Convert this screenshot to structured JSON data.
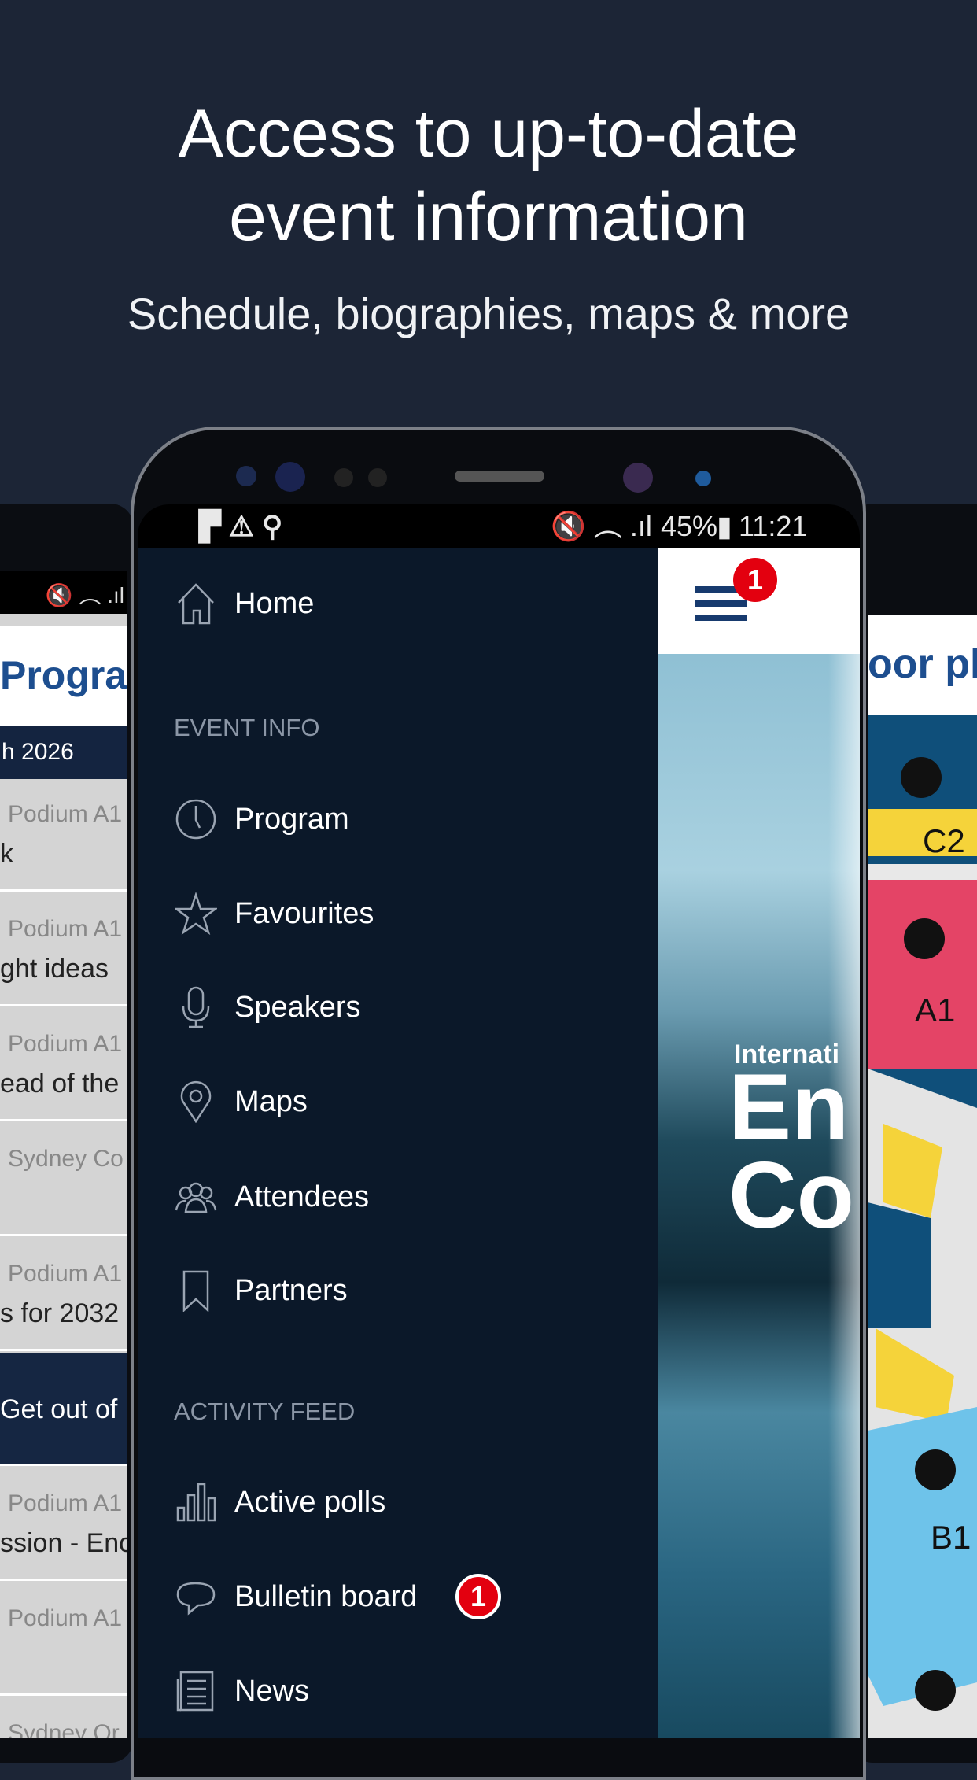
{
  "headline": {
    "line1": "Access to up-to-date",
    "line2": "event information",
    "subtitle": "Schedule, biographies, maps & more"
  },
  "status_bar": {
    "battery": "45%",
    "time": "11:21"
  },
  "drawer": {
    "home": "Home",
    "sections": [
      {
        "title": "EVENT INFO",
        "items": [
          "Program",
          "Favourites",
          "Speakers",
          "Maps",
          "Attendees",
          "Partners"
        ]
      },
      {
        "title": "ACTIVITY FEED",
        "items": [
          "Active polls",
          "Bulletin board",
          "News"
        ]
      }
    ],
    "bulletin_badge": "1"
  },
  "app_header": {
    "menu_badge": "1"
  },
  "home_banner": {
    "line1": "Internati",
    "line2": "En",
    "line3": "Co"
  },
  "left_screen": {
    "title": "Program",
    "date": "h 2026",
    "rows": [
      {
        "location": "Podium A1",
        "title": "k"
      },
      {
        "location": "Podium A1",
        "title": "ght ideas"
      },
      {
        "location": "Podium A1",
        "title": "ead of the"
      },
      {
        "location": "Sydney Co",
        "title": ""
      },
      {
        "location": "Podium A1",
        "title": "s for 2032"
      },
      {
        "location": "",
        "title": "Get out of"
      },
      {
        "location": "Podium A1",
        "title": "ssion - Enc"
      },
      {
        "location": "Podium A1",
        "title": ""
      },
      {
        "location": "Sydney Or",
        "title": ""
      }
    ]
  },
  "right_screen": {
    "title": "oor pla",
    "map_labels": [
      "C2",
      "A1",
      "B1"
    ]
  },
  "colors": {
    "background": "#1c2536",
    "drawer": "#0b1829",
    "badge": "#e3000f",
    "brand_blue": "#1d4e8f"
  }
}
